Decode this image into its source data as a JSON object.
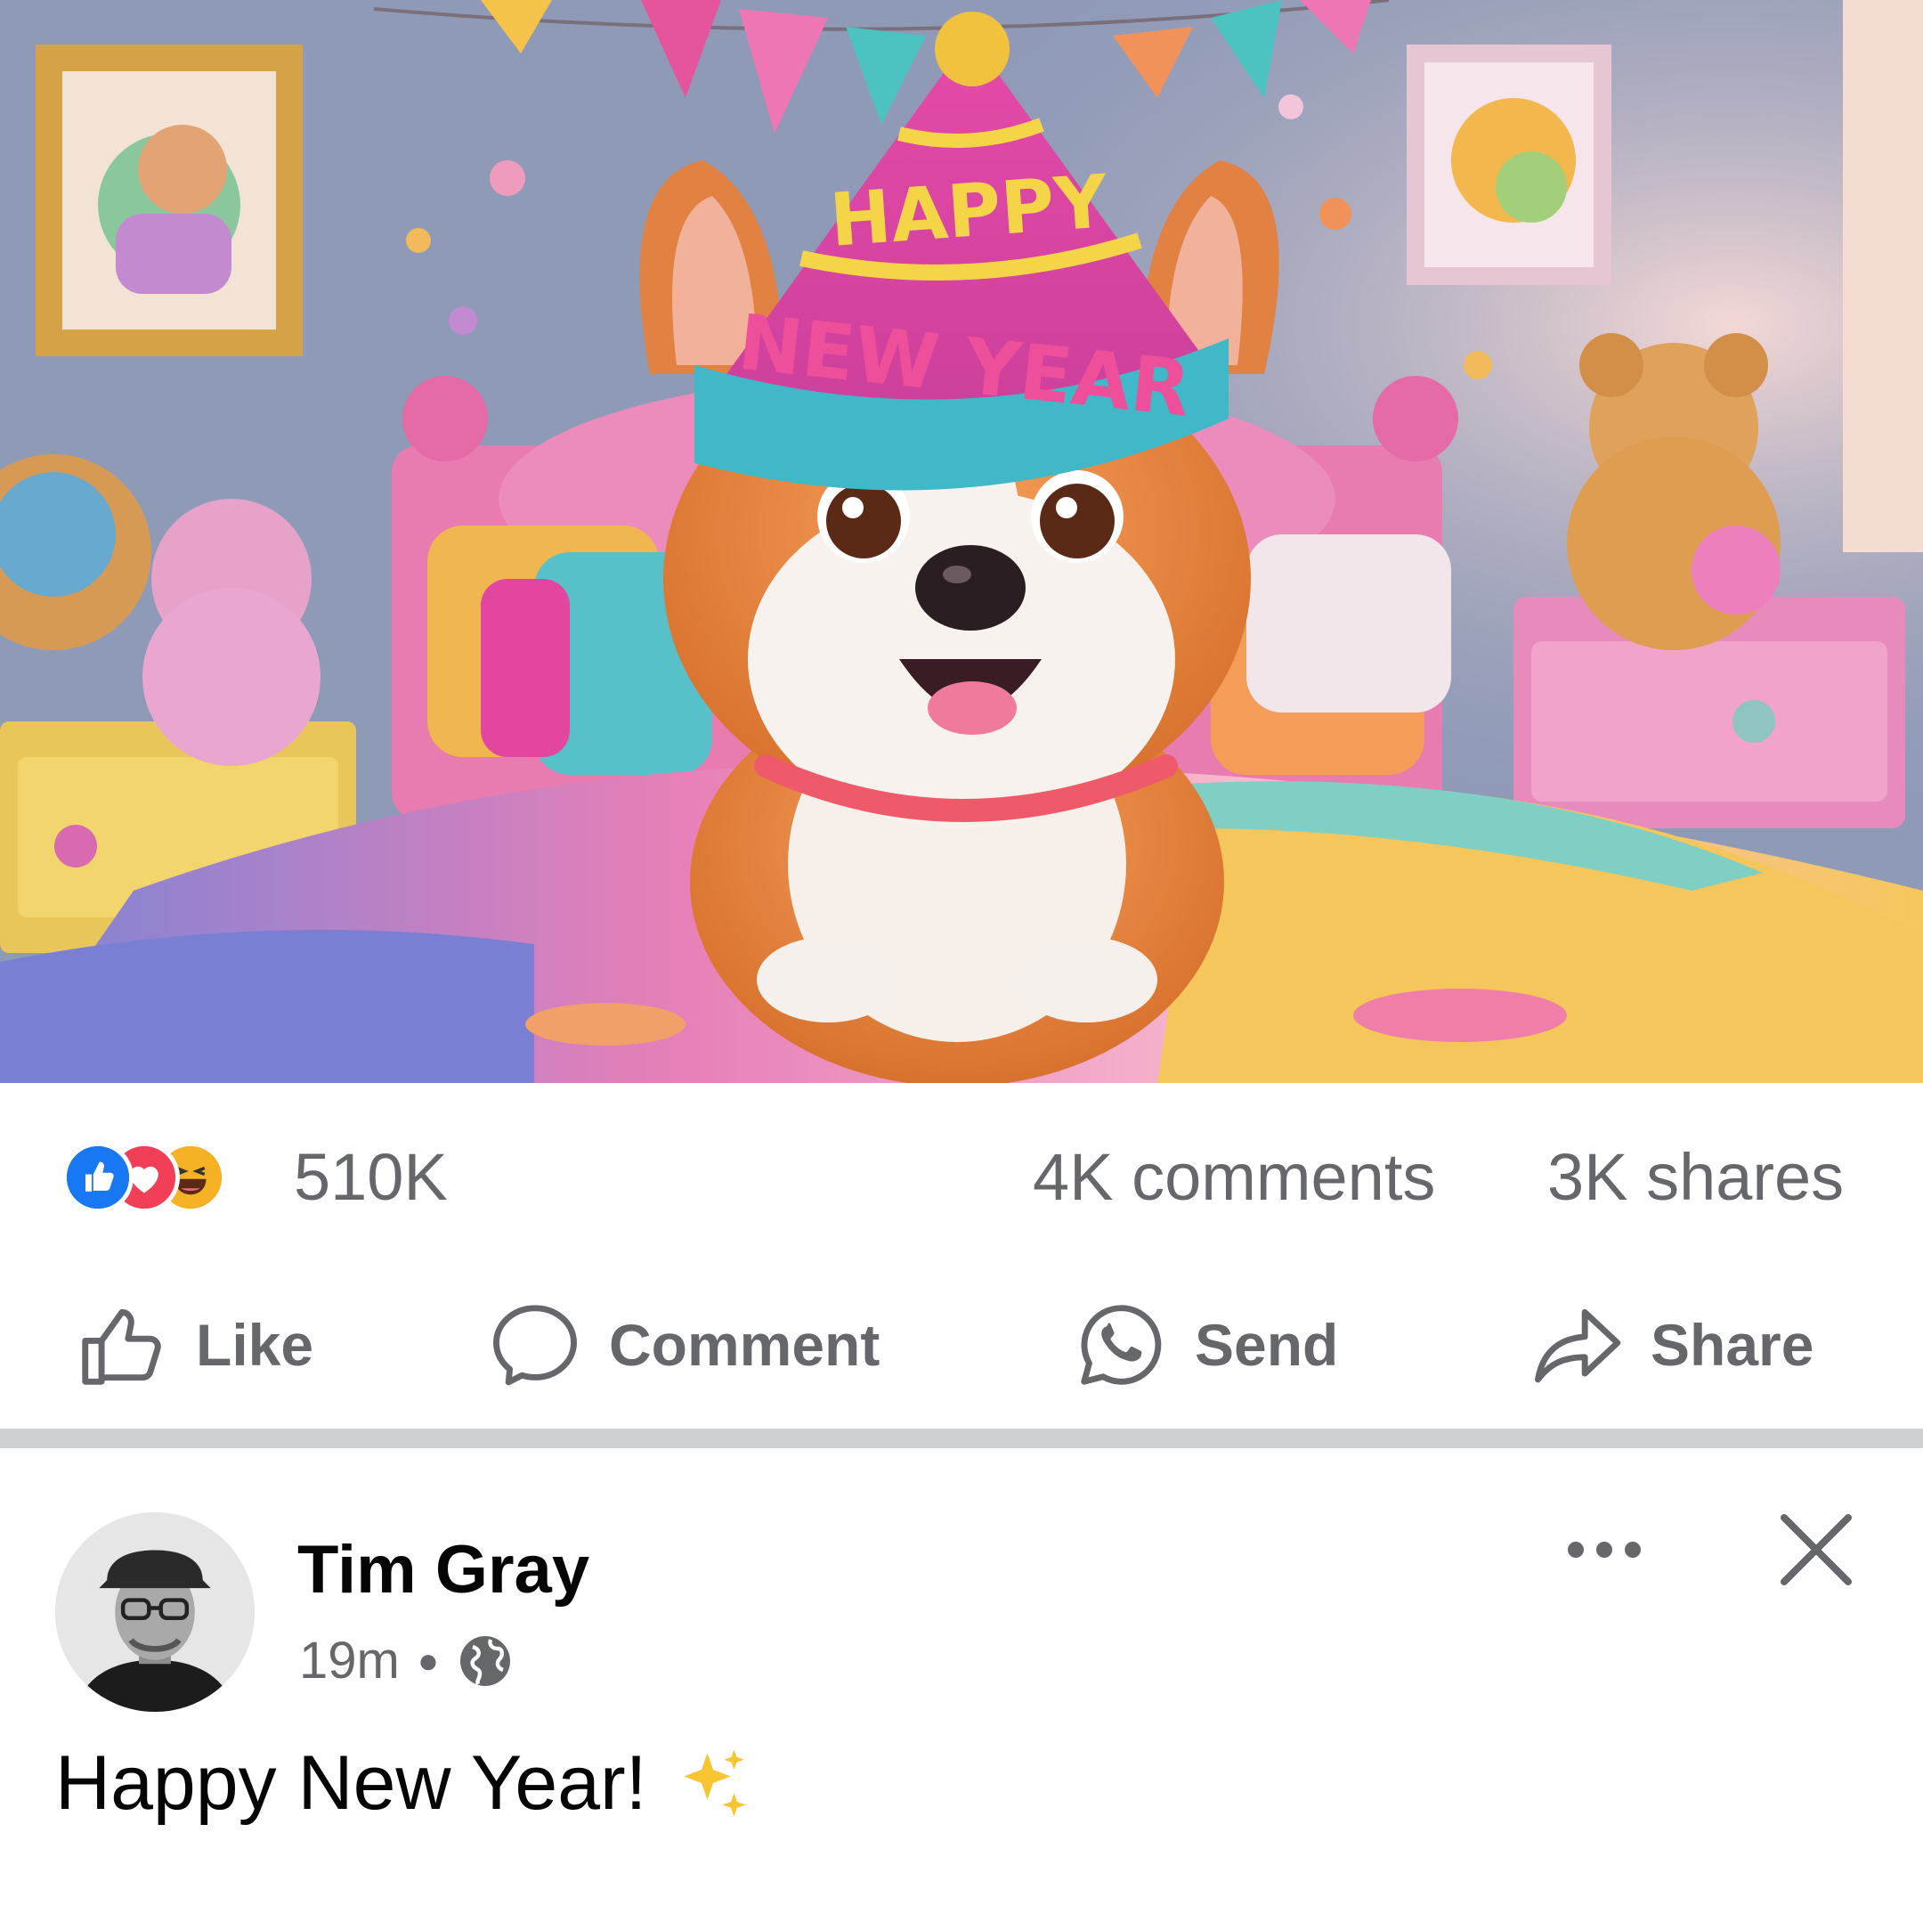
{
  "post": {
    "image_alt": "Corgi puppy wearing a Happy New Year party hat on a colorful bed",
    "hat_line1": "HAPPY",
    "hat_line2": "NEW YEAR",
    "reactions": [
      "like-icon",
      "love-icon",
      "haha-icon"
    ],
    "reaction_count": "510K",
    "comments_count": "4K comments",
    "shares_count": "3K shares"
  },
  "actions": {
    "like_label": "Like",
    "comment_label": "Comment",
    "send_label": "Send",
    "share_label": "Share"
  },
  "next_post": {
    "author": "Tim Gray",
    "time": "19m",
    "visibility_icon": "globe-icon",
    "text": "Happy New Year!",
    "emoji": "sparkles-icon"
  },
  "colors": {
    "secondary_text": "#65676b",
    "like_blue": "#1877f2",
    "love_red": "#f33e58",
    "haha_yellow": "#f7b125",
    "divider": "#ced0d4"
  }
}
